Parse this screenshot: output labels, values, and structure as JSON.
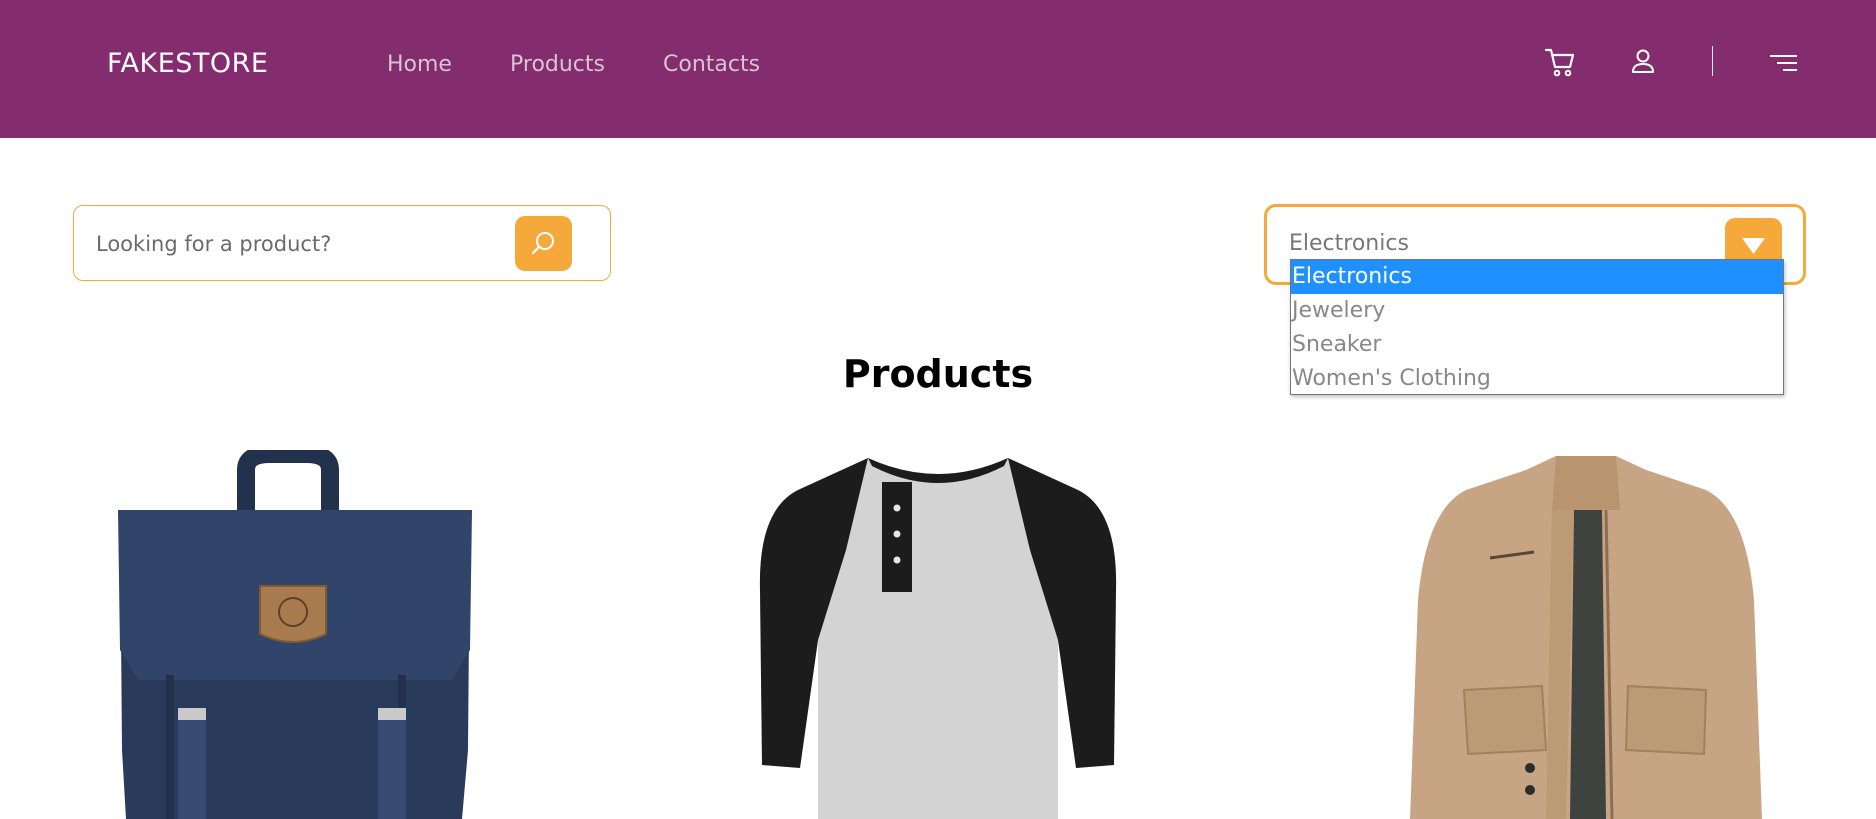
{
  "header": {
    "logo": "FAKESTORE",
    "nav": [
      "Home",
      "Products",
      "Contacts"
    ],
    "icons": [
      "cart-icon",
      "user-icon",
      "menu-icon"
    ]
  },
  "search": {
    "placeholder": "Looking for a product?"
  },
  "category_select": {
    "value": "Electronics",
    "options": [
      "Electronics",
      "Jewelery",
      "Sneaker",
      "Women's Clothing"
    ],
    "selected_index": 0
  },
  "main": {
    "title": "Products"
  },
  "colors": {
    "header_bg": "#832c6e",
    "accent": "#f4a93a",
    "selected_option": "#1e90ff"
  }
}
